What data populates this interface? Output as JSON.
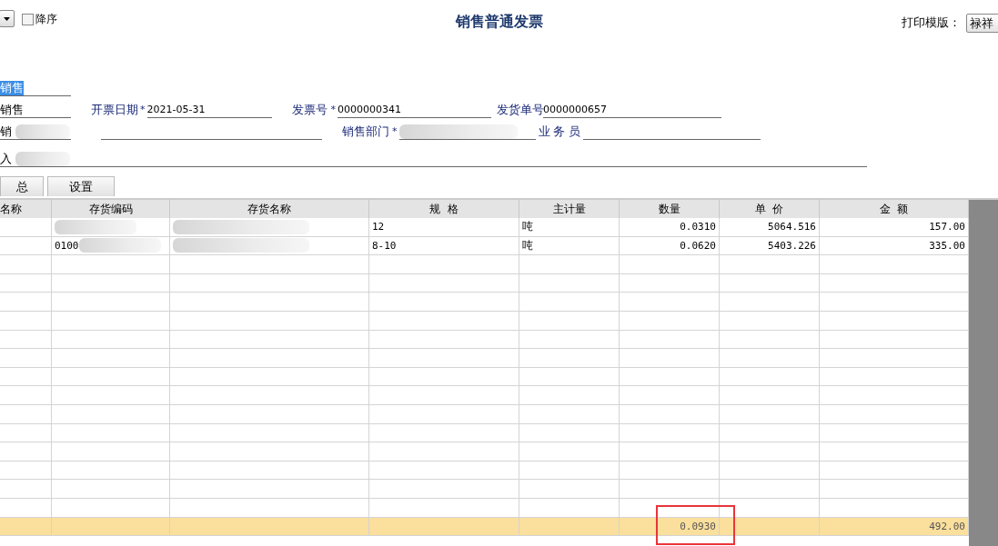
{
  "toolbar": {
    "sort_checkbox": {
      "label": "降序",
      "checked": false
    },
    "title": "销售普通发票",
    "print_template": {
      "label": "打印模版：",
      "value": "禄祥"
    }
  },
  "side_labels": [
    {
      "text": "销售",
      "selected": true
    },
    {
      "text": "销售",
      "selected": false
    },
    {
      "text": "销",
      "selected": false
    },
    {
      "text": "入",
      "selected": false
    }
  ],
  "row_1_fields": [
    {
      "label": "开票日期",
      "required_mark": "*",
      "value": "2021-05-31"
    },
    {
      "label": "发票号",
      "required_mark": "*",
      "value": "0000000341"
    },
    {
      "label": "发货单号",
      "value": "0000000657"
    }
  ],
  "row_2_fields": [
    {
      "label": "销售部门",
      "required_mark": "*"
    },
    {
      "label": "业 务 员"
    }
  ],
  "buttons": [
    "总",
    "设置"
  ],
  "table": {
    "columns": [
      "名称",
      "存货编码",
      "存货名称",
      "规  格",
      "主计量",
      "数量",
      "单  价",
      "金  额"
    ],
    "rows": [
      {
        "cells": [
          "",
          "",
          "",
          "12",
          "吨",
          "0.0310",
          "5064.516",
          "157.00"
        ]
      },
      {
        "cells": [
          "",
          "0100",
          "",
          "8-10",
          "吨",
          "0.0620",
          "5403.226",
          "335.00"
        ]
      }
    ],
    "totals": {
      "quantity": "0.0930",
      "amount": "492.00"
    }
  }
}
